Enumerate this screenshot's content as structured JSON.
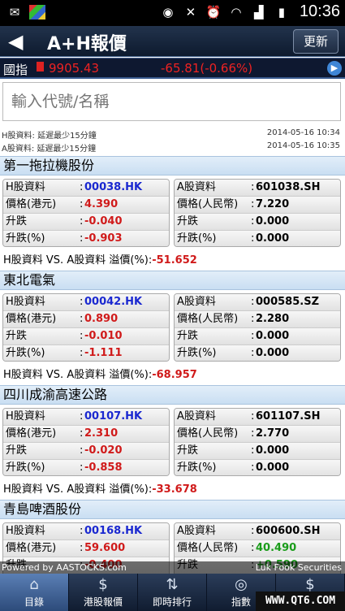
{
  "status_bar": {
    "time": "10:36"
  },
  "header": {
    "title": "A+H報價",
    "refresh_label": "更新"
  },
  "index": {
    "label": "國指",
    "value": "9905.43",
    "change": "-65.81(-0.66%)"
  },
  "search": {
    "placeholder": "輸入代號/名稱"
  },
  "info": {
    "h_note": "H股資料: 延遲最少15分鐘",
    "h_time": "2014-05-16 10:34",
    "a_note": "A股資料: 延遲最少15分鐘",
    "a_time": "2014-05-16 10:35"
  },
  "labels": {
    "h_data": "H股資料",
    "a_data": "A股資料",
    "price_hkd": "價格(港元)",
    "price_rmb": "價格(人民幣)",
    "change": "升跌",
    "change_pct": "升跌(%)",
    "colon": ":",
    "premium": "H股資料 VS. A股資料 溢價(%):"
  },
  "stocks": [
    {
      "name": "第一拖拉機股份",
      "h_code": "00038.HK",
      "h_price": "4.390",
      "h_change": "-0.040",
      "h_pct": "-0.903",
      "a_code": "601038.SH",
      "a_price": "7.220",
      "a_change": "0.000",
      "a_pct": "0.000",
      "premium": "-51.652"
    },
    {
      "name": "東北電氣",
      "h_code": "00042.HK",
      "h_price": "0.890",
      "h_change": "-0.010",
      "h_pct": "-1.111",
      "a_code": "000585.SZ",
      "a_price": "2.280",
      "a_change": "0.000",
      "a_pct": "0.000",
      "premium": "-68.957"
    },
    {
      "name": "四川成渝高速公路",
      "h_code": "00107.HK",
      "h_price": "2.310",
      "h_change": "-0.020",
      "h_pct": "-0.858",
      "a_code": "601107.SH",
      "a_price": "2.770",
      "a_change": "0.000",
      "a_pct": "0.000",
      "premium": "-33.678"
    },
    {
      "name": "青島啤酒股份",
      "h_code": "00168.HK",
      "h_price": "59.600",
      "h_change": "-0.400",
      "h_pct": "",
      "a_code": "600600.SH",
      "a_price": "40.490",
      "a_change": "+0.590",
      "a_pct": "",
      "premium": ""
    }
  ],
  "footer": {
    "powered": "Powered by AASTOCKS.com",
    "partner": "Luk Fook Securities"
  },
  "bottom_nav": [
    {
      "label": "目錄",
      "icon": "home-icon"
    },
    {
      "label": "港股報價",
      "icon": "dollar-icon"
    },
    {
      "label": "即時排行",
      "icon": "sort-icon"
    },
    {
      "label": "指數",
      "icon": "globe-icon"
    },
    {
      "label": "財經",
      "icon": "dollar-icon"
    }
  ],
  "watermark": "WWW.QT6.COM"
}
